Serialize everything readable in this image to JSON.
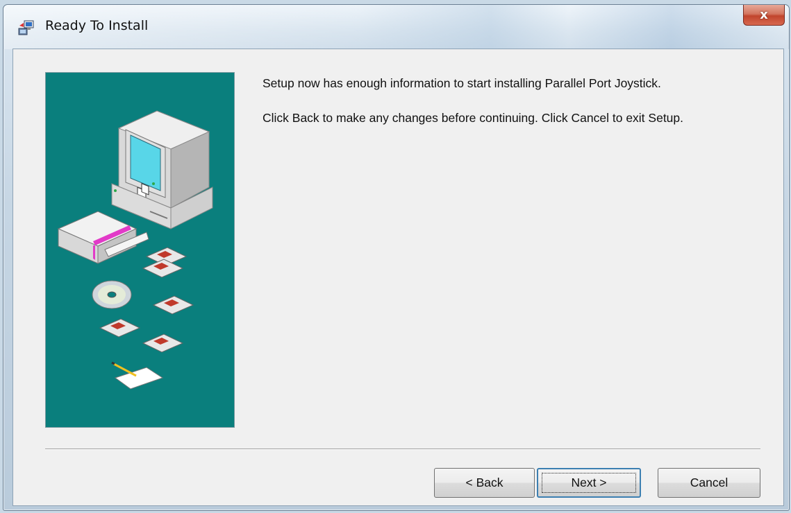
{
  "window": {
    "title": "Ready To Install",
    "close_label": "x"
  },
  "content": {
    "message_line1": "Setup now has enough information to start installing Parallel Port Joystick.",
    "message_line2": "Click Back to make any changes before continuing. Click Cancel to exit Setup."
  },
  "buttons": {
    "back_label": "< Back",
    "next_label": "Next >",
    "cancel_label": "Cancel"
  },
  "icons": {
    "app_icon": "setup-app-icon",
    "side_image": "installer-wizard-illustration"
  },
  "colors": {
    "side_panel": "#0a7f7d",
    "dialog_bg": "#f0f0f0",
    "close_button": "#c9503a"
  }
}
